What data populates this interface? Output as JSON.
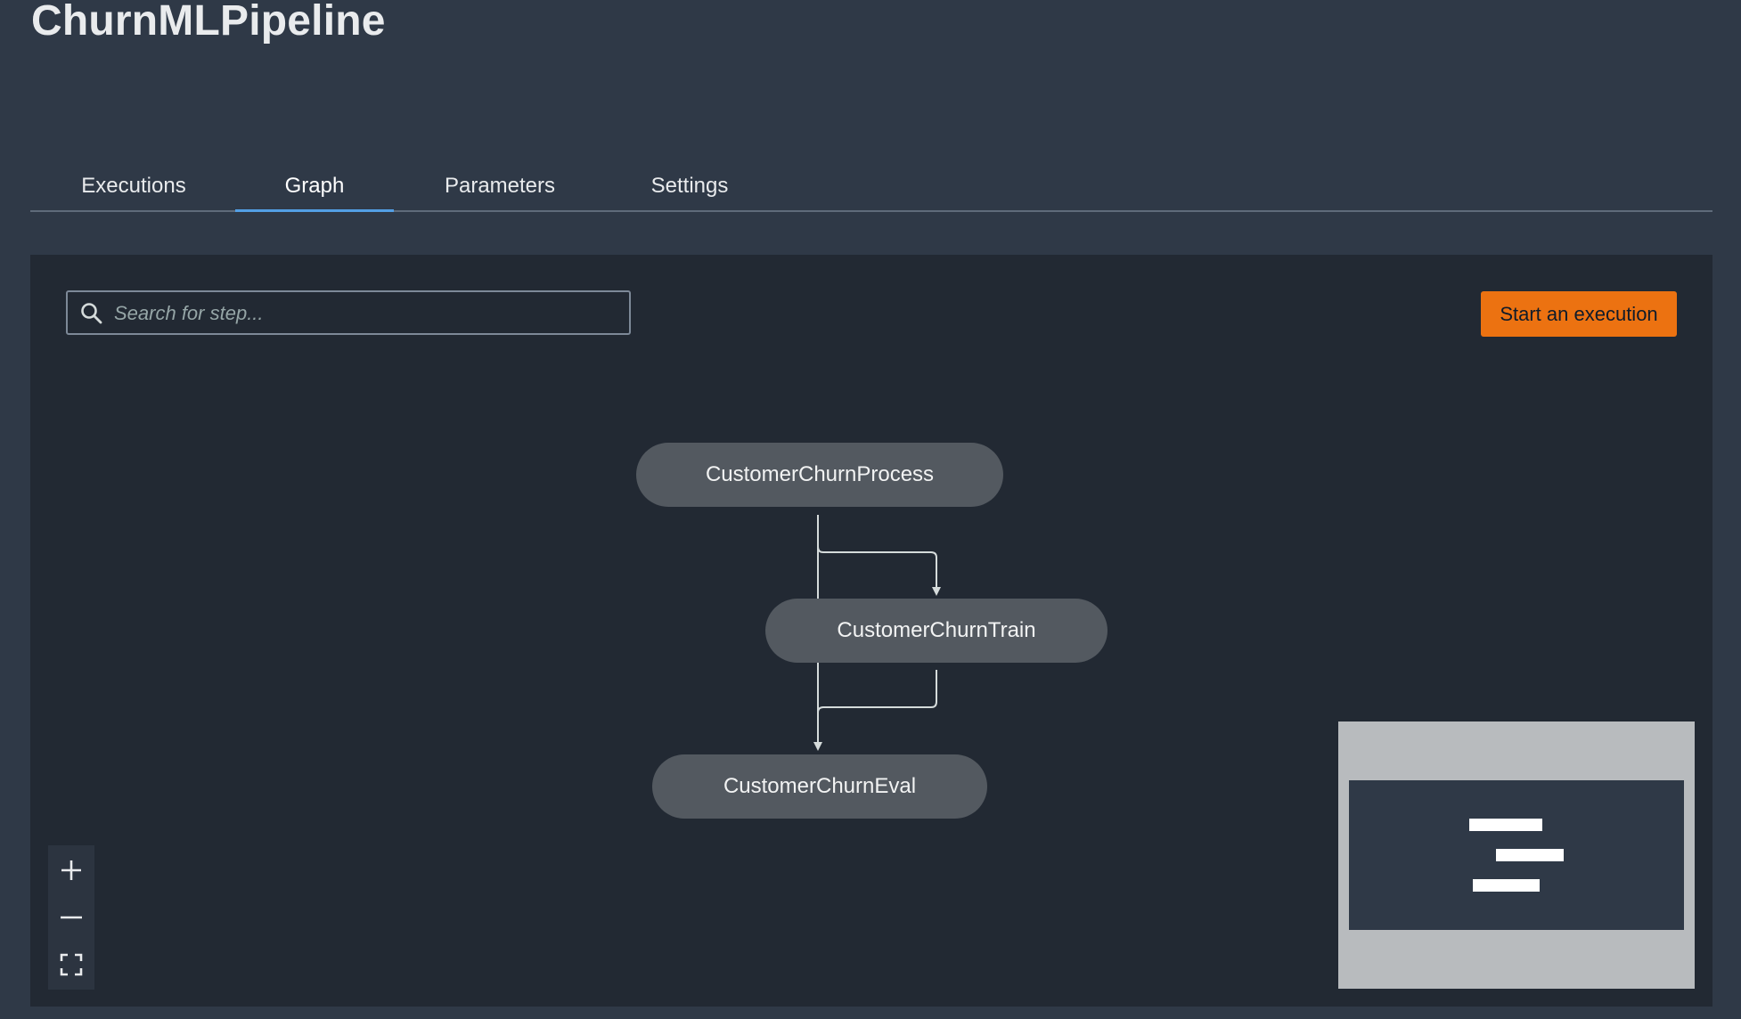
{
  "header": {
    "title": "ChurnMLPipeline"
  },
  "tabs": [
    {
      "label": "Executions",
      "active": false
    },
    {
      "label": "Graph",
      "active": true
    },
    {
      "label": "Parameters",
      "active": false
    },
    {
      "label": "Settings",
      "active": false
    }
  ],
  "toolbar": {
    "search_placeholder": "Search for step...",
    "search_value": "",
    "start_button_label": "Start an execution"
  },
  "graph": {
    "nodes": [
      {
        "label": "CustomerChurnProcess"
      },
      {
        "label": "CustomerChurnTrain"
      },
      {
        "label": "CustomerChurnEval"
      }
    ],
    "edges": [
      {
        "from": "CustomerChurnProcess",
        "to": "CustomerChurnTrain"
      },
      {
        "from": "CustomerChurnProcess",
        "to": "CustomerChurnEval"
      },
      {
        "from": "CustomerChurnTrain",
        "to": "CustomerChurnEval"
      }
    ]
  },
  "zoom_controls": {
    "zoom_in_icon": "plus-icon",
    "zoom_out_icon": "minus-icon",
    "fit_icon": "fit-view-icon"
  },
  "colors": {
    "accent": "#ec7211",
    "active_tab": "#539fe5",
    "node_fill": "#535960",
    "page_bg": "#2f3947",
    "panel_bg": "#222933"
  }
}
